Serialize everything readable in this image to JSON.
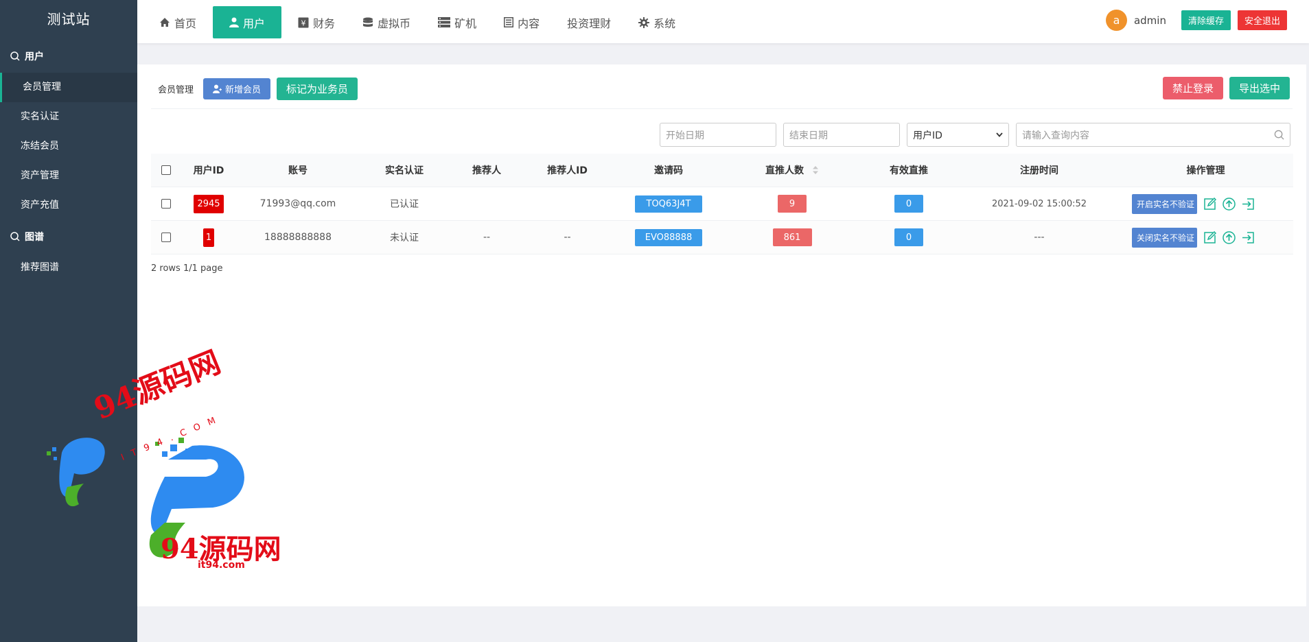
{
  "sidebar": {
    "brand": "测试站",
    "groups": [
      {
        "title": "用户",
        "items": [
          "会员管理",
          "实名认证",
          "冻结会员",
          "资产管理",
          "资产充值"
        ]
      },
      {
        "title": "图谱",
        "items": [
          "推荐图谱"
        ]
      }
    ],
    "active_item": "会员管理"
  },
  "topnav": {
    "items": [
      {
        "label": "首页",
        "icon": "home-icon"
      },
      {
        "label": "用户",
        "icon": "user-icon"
      },
      {
        "label": "财务",
        "icon": "yen-icon"
      },
      {
        "label": "虚拟币",
        "icon": "database-icon"
      },
      {
        "label": "矿机",
        "icon": "server-icon"
      },
      {
        "label": "内容",
        "icon": "document-icon"
      },
      {
        "label": "投资理财",
        "icon": ""
      },
      {
        "label": "系统",
        "icon": "gear-icon"
      }
    ],
    "active": "用户",
    "avatar_letter": "a",
    "username": "admin",
    "clear_cache": "清除缓存",
    "logout": "安全退出"
  },
  "toolbar": {
    "title": "会员管理",
    "add_member": "新增会员",
    "mark_salesman": "标记为业务员",
    "ban_login": "禁止登录",
    "export_selected": "导出选中"
  },
  "filters": {
    "start_date_placeholder": "开始日期",
    "end_date_placeholder": "结束日期",
    "field_select": "用户ID",
    "search_placeholder": "请输入查询内容"
  },
  "table": {
    "headers": [
      "用户ID",
      "账号",
      "实名认证",
      "推荐人",
      "推荐人ID",
      "邀请码",
      "直推人数",
      "有效直推",
      "注册时间",
      "操作管理"
    ],
    "rows": [
      {
        "user_id": "2945",
        "account": "71993@qq.com",
        "verified": "已认证",
        "referrer": "",
        "referrer_id": "",
        "invite_code": "TOQ63J4T",
        "direct_count": "9",
        "valid_direct": "0",
        "reg_time": "2021-09-02 15:00:52",
        "action": "开启实名不验证"
      },
      {
        "user_id": "1",
        "account": "18888888888",
        "verified": "未认证",
        "referrer": "--",
        "referrer_id": "--",
        "invite_code": "EVO88888",
        "direct_count": "861",
        "valid_direct": "0",
        "reg_time": "---",
        "action": "关闭实名不验证"
      }
    ],
    "footer": "2 rows 1/1 page"
  },
  "watermark": {
    "brand": "94源码网",
    "domain": "it94.com",
    "arc_text": "IT94.COM"
  },
  "colors": {
    "sidebar_bg": "#2f4050",
    "accent": "#1ab394",
    "danger": "#ed3535",
    "primary": "#5384d1",
    "info": "#3a9be9"
  }
}
